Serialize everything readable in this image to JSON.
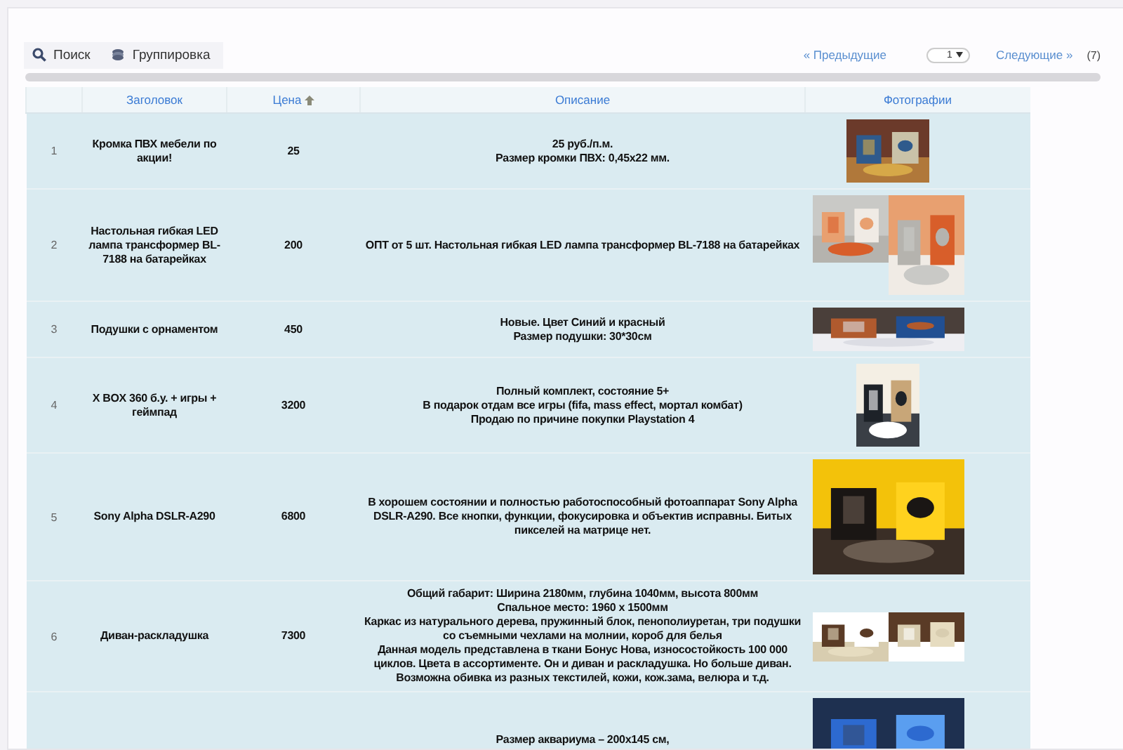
{
  "toolbar": {
    "buttons": [
      {
        "kind": "search",
        "label": "Поиск"
      },
      {
        "kind": "group",
        "label": "Группировка"
      }
    ]
  },
  "pagination": {
    "previous": "« Предыдущие",
    "page": "1",
    "next": "Следующие »",
    "total": "(7)"
  },
  "table": {
    "columns": [
      {
        "label": "Заголовок",
        "sorted": false
      },
      {
        "label": "Цена",
        "sorted": true
      },
      {
        "label": "Описание",
        "sorted": false
      },
      {
        "label": "Фотографии",
        "sorted": false
      }
    ],
    "rows": [
      {
        "number": "1",
        "title": "Кромка ПВХ мебели по акции!",
        "price": "25",
        "description": [
          "25 руб./п.м.",
          "Размер кромки ПВХ: 0,45x22 мм."
        ],
        "photos": [
          {
            "kind": "picture"
          }
        ]
      },
      {
        "number": "2",
        "title": "Настольная гибкая LED лампа трансформер BL-7188 на батарейках",
        "price": "200",
        "description": [
          "ОПТ от 5 шт. Настольная гибкая LED лампа трансформер BL-7188 на батарейках"
        ],
        "photos": [
          {
            "kind": "picture"
          },
          {
            "kind": "picture"
          }
        ]
      },
      {
        "number": "3",
        "title": "Подушки с орнаментом",
        "price": "450",
        "description": [
          "Новые. Цвет Синий и красный",
          "Размер подушки: 30*30см"
        ],
        "photos": [
          {
            "kind": "picture"
          }
        ]
      },
      {
        "number": "4",
        "title": "X BOX 360 б.у. + игры + геймпад",
        "price": "3200",
        "description": [
          "Полный комплект, состояние 5+",
          "В подарок отдам все игры (fifa, mass effect, мортал комбат)",
          "Продаю по причине покупки Playstation 4"
        ],
        "photos": [
          {
            "kind": "picture"
          }
        ]
      },
      {
        "number": "5",
        "title": "Sony Alpha DSLR-A290",
        "price": "6800",
        "description": [
          "В хорошем состоянии и полностью работоспособный фотоаппарат Sony Alpha",
          "DSLR-A290. Все кнопки, функции, фокусировка и объектив исправны. Битых",
          "пикселей на матрице нет."
        ],
        "photos": [
          {
            "kind": "picture"
          }
        ]
      },
      {
        "number": "6",
        "title": "Диван-раскладушка",
        "price": "7300",
        "description": [
          "Общий габарит: Ширина 2180мм, глубина 1040мм, высота 800мм",
          "Спальное место: 1960 x 1500мм",
          "Каркас из натурального дерева, пружинный блок, пенополиуретан, три подушки",
          "со съемными чехлами на молнии, короб для белья",
          "Данная модель представлена в ткани Бонус Нова, износостойкость 100 000",
          "циклов. Цвета в ассортименте. Он и диван и раскладушка. Но больше диван.",
          "Возможна обивка из разных текстилей, кожи, кож.зама, велюра и т.д."
        ],
        "photos": [
          {
            "kind": "picture"
          },
          {
            "kind": "picture"
          }
        ]
      },
      {
        "description": [
          "Размер аквариума – 200x145 см,"
        ],
        "photos": [
          {
            "kind": "picture"
          }
        ]
      }
    ]
  }
}
